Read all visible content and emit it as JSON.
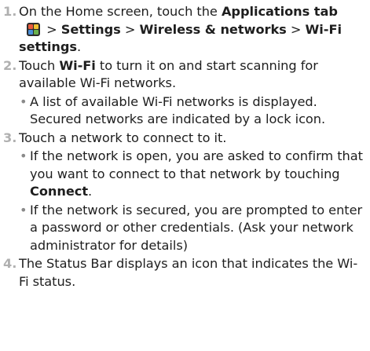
{
  "steps": [
    {
      "num": "1.",
      "t1": "On the Home screen, touch the ",
      "b1": "Applications tab",
      "t2": " > ",
      "b2": "Settings",
      "t3": " > ",
      "b3": "Wireless & networks",
      "t4": " > ",
      "b4": "Wi-Fi settings",
      "t5": "."
    },
    {
      "num": "2.",
      "t1": "Touch ",
      "b1": "Wi-Fi",
      "t2": " to turn it on and start scanning for available Wi-Fi networks.",
      "bullet": "A list of available Wi-Fi networks is displayed. Secured networks are indicated by a lock icon."
    },
    {
      "num": "3.",
      "text": "Touch a network to connect to it.",
      "bullet1_t": "If the network is open, you are asked to confirm that you want to connect to that network by touching ",
      "bullet1_b": "Connect",
      "bullet1_end": ".",
      "bullet2": "If the network is secured, you are prompted to enter a password or other credentials. (Ask your network administrator for details)"
    },
    {
      "num": "4.",
      "text": "The Status Bar displays an icon that indicates the Wi-Fi status."
    }
  ],
  "bullet_symbol": "•",
  "icons": {
    "applications_tab": "applications-grid-icon"
  },
  "colors": {
    "step_number": "#b0b0b0",
    "text": "#1e1e1e"
  }
}
